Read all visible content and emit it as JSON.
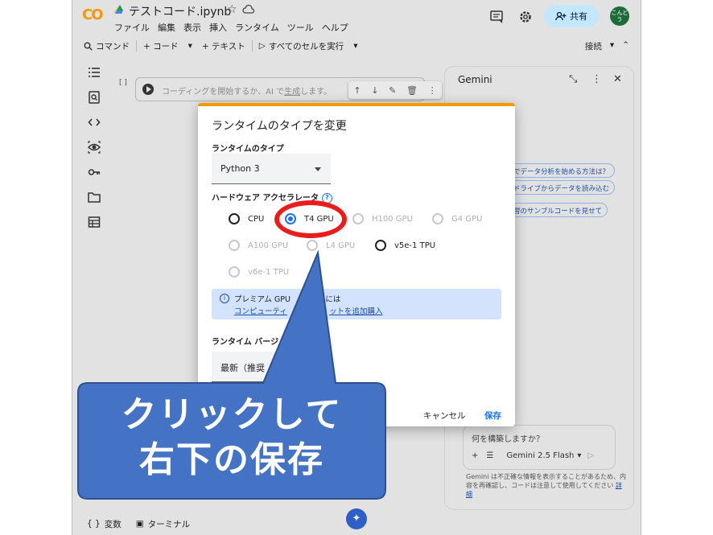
{
  "header": {
    "logo": "CO",
    "filename": "テストコード.ipynb",
    "menu": [
      "ファイル",
      "編集",
      "表示",
      "挿入",
      "ランタイム",
      "ツール",
      "ヘルプ"
    ],
    "share_label": "共有",
    "avatar_text": "こんどう"
  },
  "toolbar": {
    "command": "コマンド",
    "code": "+ コード",
    "text": "+ テキスト",
    "run_all": "すべてのセルを実行",
    "connect": "接続"
  },
  "cell": {
    "bracket": "[ ]",
    "placeholder_pre": "コーディングを開始するか、AI で",
    "placeholder_link": "生成",
    "placeholder_post": "します。"
  },
  "gemini": {
    "title": "Gemini",
    "chips": [
      "でデータ分析を始める方法は？",
      "ドライブからデータを読み込む",
      "習のサンプルコードを見せて"
    ],
    "input_placeholder": "何を構築しますか？",
    "model": "Gemini 2.5 Flash",
    "disclaimer": "Gemini は不正確な情報を表示することがあるため、内容を再確認し、コードは注意して使用してください",
    "disclaimer_link": "詳細"
  },
  "bottom": {
    "variables": "変数",
    "terminal": "ターミナル"
  },
  "dialog": {
    "title": "ランタイムのタイプを変更",
    "runtime_type_label": "ランタイムのタイプ",
    "runtime_type_value": "Python 3",
    "accelerator_label": "ハードウェア アクセラレータ",
    "options": [
      {
        "label": "CPU",
        "enabled": true,
        "selected": false
      },
      {
        "label": "T4 GPU",
        "enabled": true,
        "selected": true
      },
      {
        "label": "H100 GPU",
        "enabled": false,
        "selected": false
      },
      {
        "label": "G4 GPU",
        "enabled": false,
        "selected": false
      },
      {
        "label": "A100 GPU",
        "enabled": false,
        "selected": false
      },
      {
        "label": "L4 GPU",
        "enabled": false,
        "selected": false
      },
      {
        "label": "v5e-1 TPU",
        "enabled": true,
        "selected": false
      },
      {
        "label": "v6e-1 TPU",
        "enabled": false,
        "selected": false
      }
    ],
    "info_text": "プレミアム GPU",
    "info_text2": "るには",
    "info_link_a": "コンピューティ",
    "info_link_b": "ットを追加購入",
    "version_label": "ランタイム バージ",
    "version_value": "最新（推奨",
    "cancel": "キャンセル",
    "save": "保存"
  },
  "annotation": {
    "line1": "クリックして",
    "line2": "右下の保存"
  },
  "colors": {
    "accent": "#1a73e8",
    "callout": "#4472c4",
    "highlight": "#ea1d1d"
  }
}
